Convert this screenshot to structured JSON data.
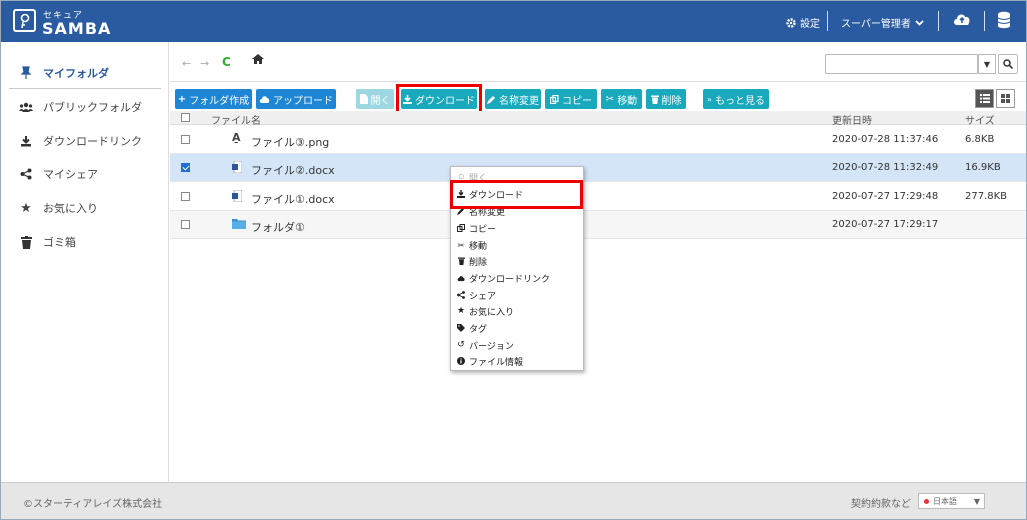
{
  "header": {
    "logo_sub": "セキュア",
    "logo_main": "SAMBA",
    "settings_label": "設定",
    "admin_label": "スーパー管理者"
  },
  "sidebar": {
    "items": [
      {
        "label": "マイフォルダ",
        "icon": "pin-icon",
        "active": true
      },
      {
        "label": "パブリックフォルダ",
        "icon": "users-icon"
      },
      {
        "label": "ダウンロードリンク",
        "icon": "download-icon"
      },
      {
        "label": "マイシェア",
        "icon": "share-icon"
      },
      {
        "label": "お気に入り",
        "icon": "star-icon"
      },
      {
        "label": "ゴミ箱",
        "icon": "trash-icon"
      }
    ]
  },
  "search": {
    "value": "",
    "placeholder": ""
  },
  "toolbar": {
    "new_folder": "フォルダ作成",
    "upload": "アップロード",
    "open": "開く",
    "download": "ダウンロード",
    "rename": "名称変更",
    "copy": "コピー",
    "move": "移動",
    "delete": "削除",
    "more": "もっと見る"
  },
  "table": {
    "headers": {
      "name": "ファイル名",
      "updated": "更新日時",
      "size": "サイズ"
    },
    "rows": [
      {
        "name": "ファイル③.png",
        "updated": "2020-07-28 11:37:46",
        "size": "6.8KB",
        "checked": false,
        "icon": "image-file-icon"
      },
      {
        "name": "ファイル②.docx",
        "updated": "2020-07-28 11:32:49",
        "size": "16.9KB",
        "checked": true,
        "icon": "word-file-icon"
      },
      {
        "name": "ファイル①.docx",
        "updated": "2020-07-27 17:29:48",
        "size": "277.8KB",
        "checked": false,
        "icon": "word-file-icon"
      },
      {
        "name": "フォルダ①",
        "updated": "2020-07-27 17:29:17",
        "size": "",
        "checked": false,
        "icon": "folder-icon"
      }
    ]
  },
  "context_menu": {
    "items": [
      {
        "label": "開く",
        "icon": "open-icon",
        "disabled": true
      },
      {
        "label": "ダウンロード",
        "icon": "download-icon"
      },
      {
        "label": "名称変更",
        "icon": "pencil-icon"
      },
      {
        "label": "コピー",
        "icon": "copy-icon"
      },
      {
        "label": "移動",
        "icon": "scissors-icon"
      },
      {
        "label": "削除",
        "icon": "trash-icon"
      },
      {
        "label": "ダウンロードリンク",
        "icon": "cloud-download-icon"
      },
      {
        "label": "シェア",
        "icon": "share-icon"
      },
      {
        "label": "お気に入り",
        "icon": "star-icon"
      },
      {
        "label": "タグ",
        "icon": "tag-icon"
      },
      {
        "label": "バージョン",
        "icon": "history-icon"
      },
      {
        "label": "ファイル情報",
        "icon": "info-icon"
      }
    ]
  },
  "footer": {
    "copyright": "©スターティアレイズ株式会社",
    "links": "契約約款など",
    "language": "日本語"
  },
  "colors": {
    "header_bg": "#2a5aa0",
    "btn_blue": "#1f86d6",
    "btn_teal": "#18a9bd",
    "highlight": "#ee0000",
    "selected_row": "#d4e5f7"
  }
}
